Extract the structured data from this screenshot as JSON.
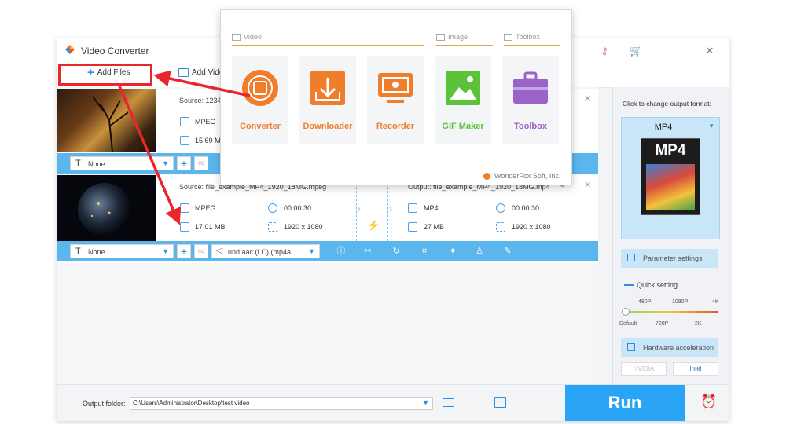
{
  "window": {
    "title": "Video Converter"
  },
  "toolbar": {
    "add_files": "Add Files",
    "add_video": "Add Vide"
  },
  "files": [
    {
      "source": "Source: 1234",
      "format": "MPEG",
      "size": "15.69 M",
      "subtitle": "None"
    },
    {
      "source": "Source: file_example_MP4_1920_18MG.mpeg",
      "format": "MPEG",
      "duration": "00:00:30",
      "size": "17.01 MB",
      "resolution": "1920 x 1080",
      "output": "Output: file_example_MP4_1920_18MG.mp4",
      "out_format": "MP4",
      "out_duration": "00:00:30",
      "out_size": "27 MB",
      "out_resolution": "1920 x 1080",
      "subtitle": "None",
      "audio": "und aac (LC) (mp4a"
    }
  ],
  "right_panel": {
    "hint": "Click to change output format:",
    "format": "MP4",
    "format_badge": "MP4",
    "parameter_settings": "Parameter settings",
    "quick_setting": "Quick setting",
    "quality_top": [
      "480P",
      "1080P",
      "4K"
    ],
    "quality_bottom": [
      "Default",
      "720P",
      "2K"
    ],
    "hardware_acceleration": "Hardware acceleration",
    "nvidia": "NVIDIA",
    "intel": "Intel"
  },
  "bottom": {
    "output_folder_label": "Output folder:",
    "output_folder_value": "C:\\Users\\Administrator\\Desktop\\test video",
    "run": "Run"
  },
  "popup": {
    "categories": {
      "video": "Video",
      "image": "Image",
      "toolbox": "Toolbox"
    },
    "tiles": [
      {
        "label": "Converter",
        "color": "#f07d2a"
      },
      {
        "label": "Downloader",
        "color": "#f07d2a"
      },
      {
        "label": "Recorder",
        "color": "#f07d2a"
      },
      {
        "label": "GIF Maker",
        "color": "#5cc23a"
      },
      {
        "label": "Toolbox",
        "color": "#9a63c7"
      }
    ],
    "brand": "WonderFox Soft, Inc."
  },
  "colors": {
    "accent": "#2aa4f4",
    "annotation": "#e8262b",
    "bar": "#5bb6ee"
  }
}
